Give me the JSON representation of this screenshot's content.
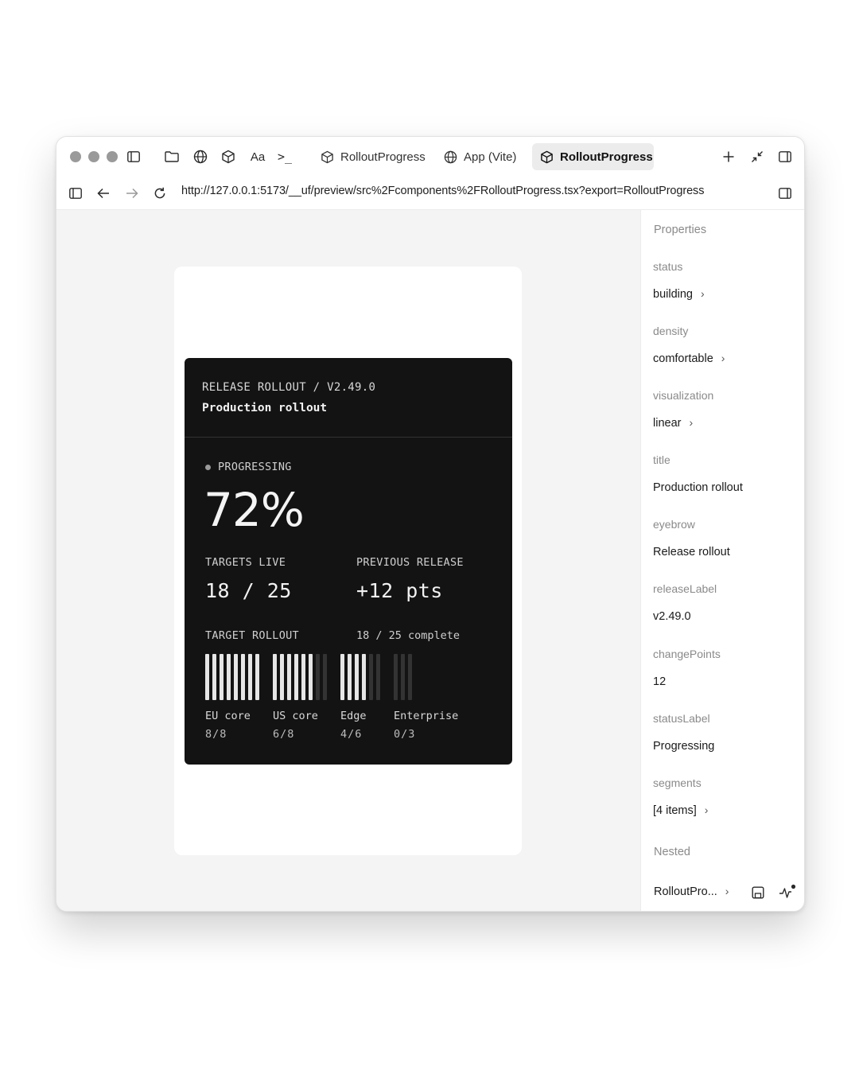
{
  "browser": {
    "tabs": [
      {
        "label": "RolloutProgress",
        "icon": "cube-icon",
        "active": false
      },
      {
        "label": "App (Vite)",
        "icon": "globe-icon",
        "active": false
      },
      {
        "label": "RolloutProgress",
        "icon": "cube-icon",
        "active": true
      }
    ],
    "toolbar_text_icon": "Aa",
    "terminal_icon": ">_",
    "url": "http://127.0.0.1:5173/__uf/preview/src%2Fcomponents%2FRolloutProgress.tsx?export=RolloutProgress"
  },
  "card": {
    "eyebrow": "RELEASE ROLLOUT / V2.49.0",
    "title": "Production rollout",
    "status": "PROGRESSING",
    "percent_text": "72%",
    "percent": 72,
    "targets_label": "TARGETS LIVE",
    "targets_value": "18 / 25",
    "previous_label": "PREVIOUS RELEASE",
    "previous_value": "+12 pts",
    "rollout_label": "TARGET ROLLOUT",
    "rollout_count": "18 / 25 complete",
    "segments": [
      {
        "name": "EU core",
        "fraction": "8/8",
        "done": 8,
        "total": 8
      },
      {
        "name": "US core",
        "fraction": "6/8",
        "done": 6,
        "total": 8
      },
      {
        "name": "Edge",
        "fraction": "4/6",
        "done": 4,
        "total": 6
      },
      {
        "name": "Enterprise",
        "fraction": "0/3",
        "done": 0,
        "total": 3
      }
    ]
  },
  "panel": {
    "title": "Properties",
    "props": [
      {
        "label": "status",
        "value": "building",
        "chevron": true
      },
      {
        "label": "density",
        "value": "comfortable",
        "chevron": true
      },
      {
        "label": "visualization",
        "value": "linear",
        "chevron": true
      },
      {
        "label": "title",
        "value": "Production rollout",
        "chevron": false
      },
      {
        "label": "eyebrow",
        "value": "Release rollout",
        "chevron": false
      },
      {
        "label": "releaseLabel",
        "value": "v2.49.0",
        "chevron": false
      },
      {
        "label": "changePoints",
        "value": "12",
        "chevron": false
      },
      {
        "label": "statusLabel",
        "value": "Progressing",
        "chevron": false
      },
      {
        "label": "segments",
        "value": "[4 items]",
        "chevron": true
      }
    ],
    "nested_title": "Nested",
    "nested_item": "RolloutPro...",
    "chevron": "›"
  },
  "colors": {
    "card_bg": "#131313",
    "bar_done": "#e6e6e6",
    "bar_pending": "#333333"
  }
}
